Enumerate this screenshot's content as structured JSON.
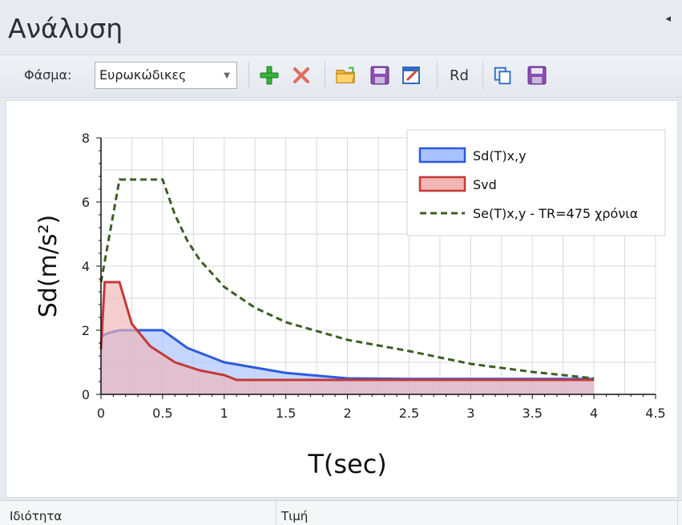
{
  "window": {
    "title": "Ανάλυση",
    "pin_icon": "◂"
  },
  "toolbar": {
    "spectrum_label": "Φάσμα:",
    "spectrum_value": "Ευρωκώδικες",
    "rd_label": "Rd",
    "icons": [
      "add-icon",
      "delete-icon",
      "open-folder-icon",
      "save-icon",
      "edit-icon",
      "copy-icon",
      "save-icon"
    ]
  },
  "chart_data": {
    "type": "line",
    "xlabel": "T(sec)",
    "ylabel": "Sd(m/s²)",
    "xlim": [
      0,
      4.5
    ],
    "ylim": [
      0,
      8
    ],
    "xticks": [
      "0",
      "0.5",
      "1",
      "1.5",
      "2",
      "2.5",
      "3",
      "3.5",
      "4",
      "4.5"
    ],
    "yticks": [
      "0",
      "2",
      "4",
      "6",
      "8"
    ],
    "grid": true,
    "legend_position": "top-right",
    "series": [
      {
        "name": "Sd(T)x,y",
        "style": "area",
        "color": "#2e5bdc",
        "fill": "#a7c1ff",
        "x": [
          0,
          0.05,
          0.15,
          0.5,
          0.7,
          1.0,
          1.5,
          2.0,
          2.5,
          3.0,
          3.5,
          4.0
        ],
        "y": [
          1.8,
          1.9,
          2.0,
          2.0,
          1.45,
          1.0,
          0.67,
          0.5,
          0.48,
          0.48,
          0.48,
          0.48
        ]
      },
      {
        "name": "Svd",
        "style": "area",
        "color": "#c33a3a",
        "fill": "#f0b6b6",
        "x": [
          0,
          0.03,
          0.15,
          0.25,
          0.4,
          0.6,
          0.8,
          1.0,
          1.1,
          1.5,
          2.0,
          2.5,
          3.0,
          3.5,
          4.0
        ],
        "y": [
          1.4,
          3.5,
          3.5,
          2.2,
          1.5,
          1.0,
          0.75,
          0.6,
          0.45,
          0.45,
          0.45,
          0.45,
          0.45,
          0.45,
          0.45
        ]
      },
      {
        "name": "Se(T)x,y - TR=475 χρόνια",
        "style": "dashed",
        "color": "#3d5e23",
        "x": [
          0,
          0.15,
          0.5,
          0.6,
          0.7,
          0.8,
          1.0,
          1.25,
          1.5,
          2.0,
          2.5,
          3.0,
          3.5,
          4.0
        ],
        "y": [
          3.5,
          6.7,
          6.7,
          5.6,
          4.8,
          4.2,
          3.35,
          2.7,
          2.25,
          1.7,
          1.35,
          0.95,
          0.7,
          0.5
        ]
      }
    ]
  },
  "properties": {
    "col1": "Ιδιότητα",
    "col2": "Τιμή"
  }
}
